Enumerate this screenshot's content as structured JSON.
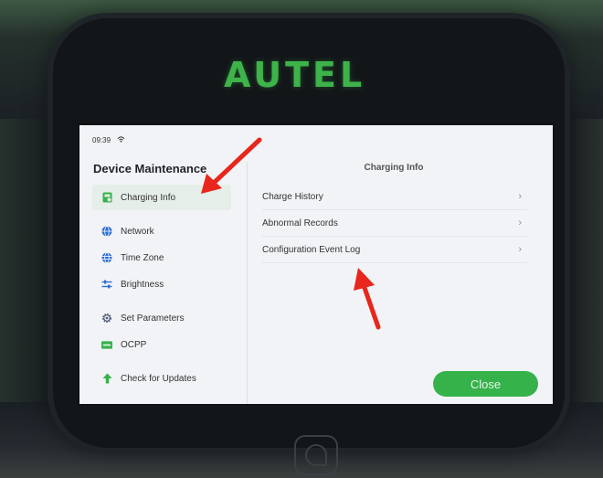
{
  "device": {
    "brand": "AUTEL"
  },
  "status_bar": {
    "time": "09:39",
    "wifi_icon": "wifi-icon"
  },
  "page": {
    "title": "Device Maintenance"
  },
  "sidebar": {
    "items": [
      {
        "label": "Charging Info",
        "icon": "charging-info-icon",
        "active": true
      },
      {
        "label": "Network",
        "icon": "globe-icon"
      },
      {
        "label": "Time Zone",
        "icon": "globe-clock-icon"
      },
      {
        "label": "Brightness",
        "icon": "sliders-icon"
      },
      {
        "label": "Set Parameters",
        "icon": "gear-icon"
      },
      {
        "label": "OCPP",
        "icon": "ocpp-icon"
      },
      {
        "label": "Check for Updates",
        "icon": "arrow-up-icon"
      }
    ]
  },
  "content": {
    "title": "Charging Info",
    "rows": [
      {
        "label": "Charge History"
      },
      {
        "label": "Abnormal Records"
      },
      {
        "label": "Configuration Event Log"
      }
    ]
  },
  "actions": {
    "close_label": "Close"
  },
  "colors": {
    "accent": "#36b24a",
    "annotation": "#e8261c",
    "logo": "#3db34a"
  }
}
